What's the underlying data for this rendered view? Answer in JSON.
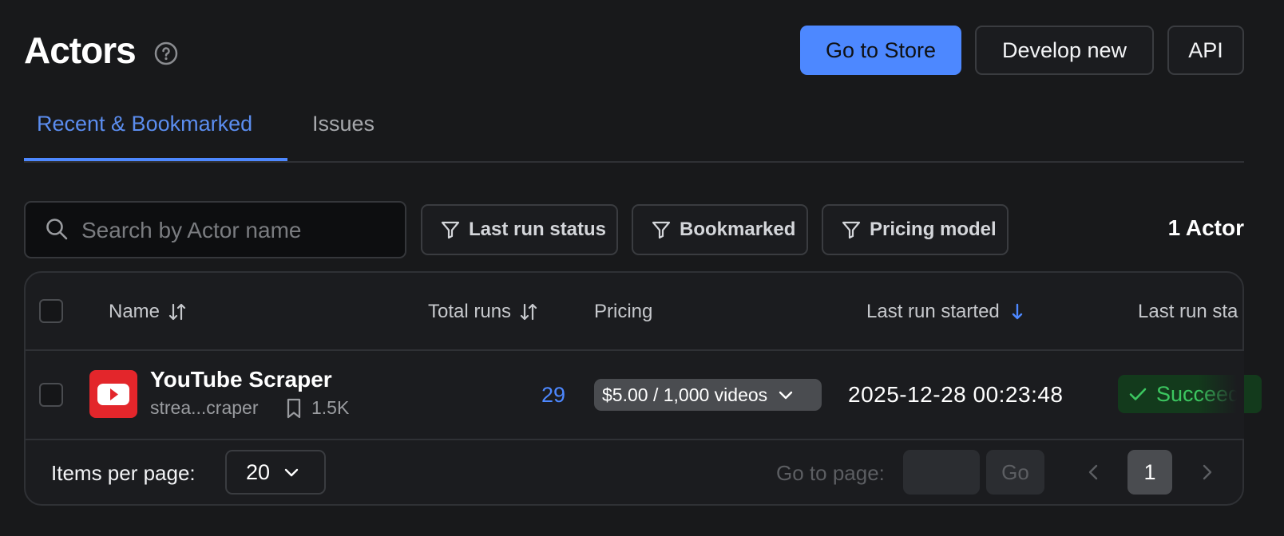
{
  "header": {
    "title": "Actors",
    "buttons": {
      "store": "Go to Store",
      "develop": "Develop new",
      "api": "API"
    }
  },
  "tabs": [
    {
      "label": "Recent & Bookmarked",
      "active": true
    },
    {
      "label": "Issues",
      "active": false
    }
  ],
  "search": {
    "placeholder": "Search by Actor name",
    "value": ""
  },
  "filters": [
    "Last run status",
    "Bookmarked",
    "Pricing model"
  ],
  "count_label": "1 Actor",
  "table": {
    "columns": {
      "name": "Name",
      "total_runs": "Total runs",
      "pricing": "Pricing",
      "last_run_started": "Last run started",
      "last_run_status": "Last run sta"
    },
    "rows": [
      {
        "title": "YouTube Scraper",
        "slug": "strea...craper",
        "bookmarks": "1.5K",
        "total_runs": "29",
        "pricing": "$5.00 / 1,000 videos",
        "last_run_started": "2025-12-28 00:23:48",
        "status": "Succeed"
      }
    ]
  },
  "footer": {
    "items_per_page_label": "Items per page:",
    "items_per_page": "20",
    "goto_label": "Go to page:",
    "go_button": "Go",
    "current_page": "1"
  },
  "colors": {
    "accent": "#4d88ff",
    "background": "#18191b",
    "success": "#3cc760",
    "youtube_red": "#e3262b"
  }
}
